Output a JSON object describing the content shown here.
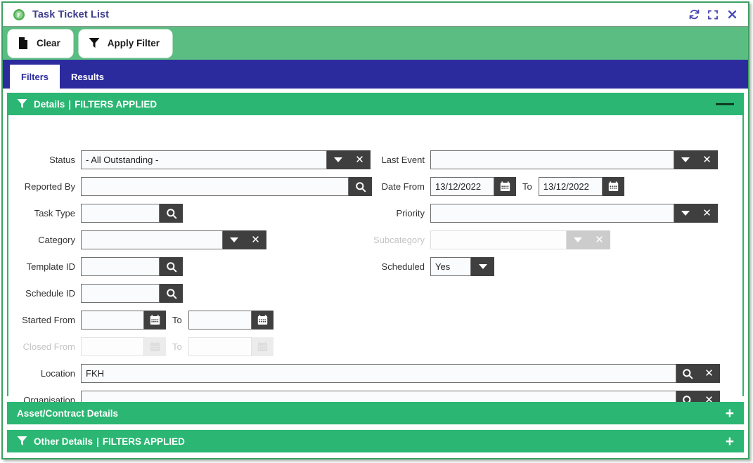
{
  "window": {
    "title": "Task Ticket List",
    "app_icon": "app-badge-icon",
    "actions": [
      {
        "name": "refresh-icon",
        "label": "Refresh"
      },
      {
        "name": "maximize-icon",
        "label": "Maximize"
      },
      {
        "name": "close-icon",
        "label": "Close"
      }
    ]
  },
  "toolbar": {
    "clear_label": "Clear",
    "apply_filter_label": "Apply Filter"
  },
  "tabs": [
    {
      "label": "Filters",
      "active": true
    },
    {
      "label": "Results",
      "active": false
    }
  ],
  "sections": {
    "details": {
      "title": "Details",
      "separator": "|",
      "status_text": "FILTERS APPLIED",
      "toggle": "—",
      "toggle_state": "expanded"
    },
    "asset_contract": {
      "title": "Asset/Contract Details",
      "toggle": "+",
      "toggle_state": "collapsed"
    },
    "other": {
      "title": "Other Details",
      "separator": "|",
      "status_text": "FILTERS APPLIED",
      "toggle": "+",
      "toggle_state": "collapsed"
    }
  },
  "form": {
    "status": {
      "label": "Status",
      "value": "- All Outstanding -"
    },
    "reported_by": {
      "label": "Reported By",
      "value": ""
    },
    "task_type": {
      "label": "Task Type",
      "value": ""
    },
    "category": {
      "label": "Category",
      "value": ""
    },
    "template_id": {
      "label": "Template ID",
      "value": ""
    },
    "schedule_id": {
      "label": "Schedule ID",
      "value": ""
    },
    "started_from": {
      "label": "Started From",
      "value": "",
      "to_label": "To",
      "to_value": ""
    },
    "closed_from": {
      "label": "Closed From",
      "value": "",
      "to_label": "To",
      "to_value": "",
      "disabled": true
    },
    "location": {
      "label": "Location",
      "value": "FKH"
    },
    "organisation": {
      "label": "Organisation",
      "value": ""
    },
    "last_event": {
      "label": "Last Event",
      "value": ""
    },
    "date_from": {
      "label": "Date From",
      "value": "13/12/2022",
      "to_label": "To",
      "to_value": "13/12/2022"
    },
    "priority": {
      "label": "Priority",
      "value": ""
    },
    "subcategory": {
      "label": "Subcategory",
      "value": "",
      "disabled": true
    },
    "scheduled": {
      "label": "Scheduled",
      "value": "Yes"
    }
  },
  "colors": {
    "toolbar_green": "#5cbd82",
    "section_green": "#2bb673",
    "tab_blue": "#2b2b9e",
    "title_text": "#3c3c8c",
    "dark_button": "#3f3f3f",
    "disabled_grey": "#cccccc"
  }
}
